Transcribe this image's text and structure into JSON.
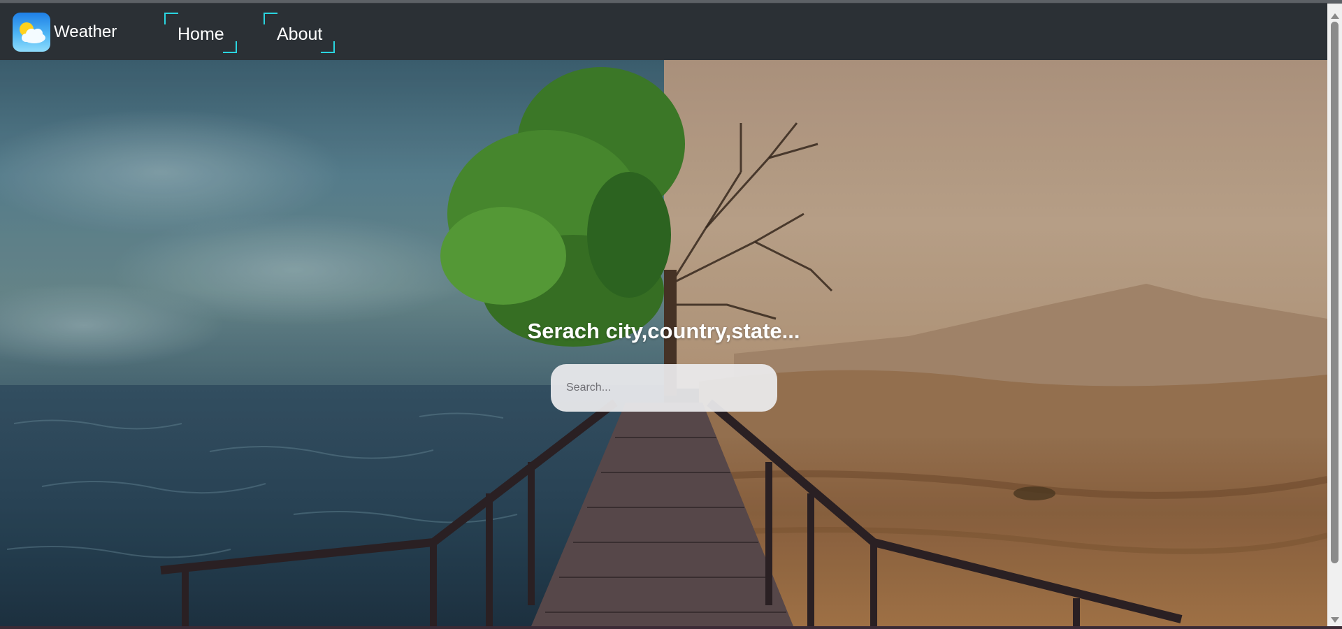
{
  "navbar": {
    "brand": {
      "icon": "weather-logo-icon",
      "label": "Weather"
    },
    "links": [
      {
        "label": "Home"
      },
      {
        "label": "About"
      }
    ],
    "accent_color": "#2ad5e0"
  },
  "hero": {
    "heading": "Serach city,country,state...",
    "search": {
      "placeholder": "Search...",
      "value": ""
    }
  }
}
